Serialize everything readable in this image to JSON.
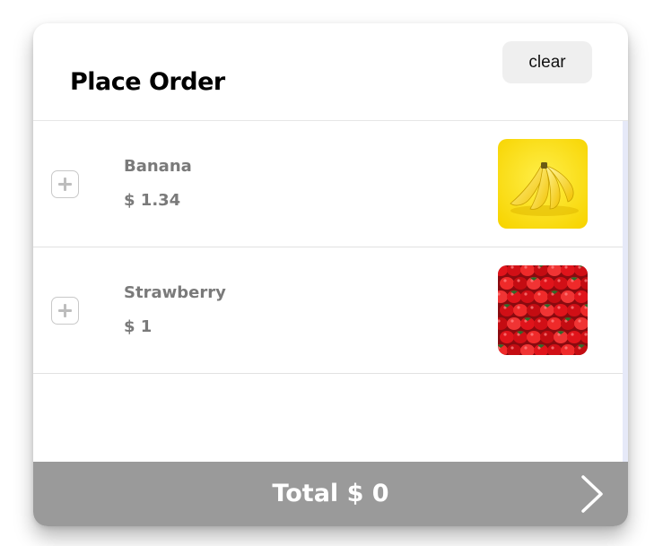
{
  "header": {
    "title": "Place Order",
    "clear_label": "clear"
  },
  "items": [
    {
      "name": "Banana",
      "price": "$ 1.34",
      "image_icon": "banana-image"
    },
    {
      "name": "Strawberry",
      "price": "$ 1",
      "image_icon": "strawberry-image"
    }
  ],
  "footer": {
    "total_label": "Total $ 0",
    "next_icon": "chevron-right-icon"
  },
  "colors": {
    "footer_bg": "#9a9a9a",
    "text_muted": "#7a7a7a",
    "clear_bg": "#efefef"
  }
}
